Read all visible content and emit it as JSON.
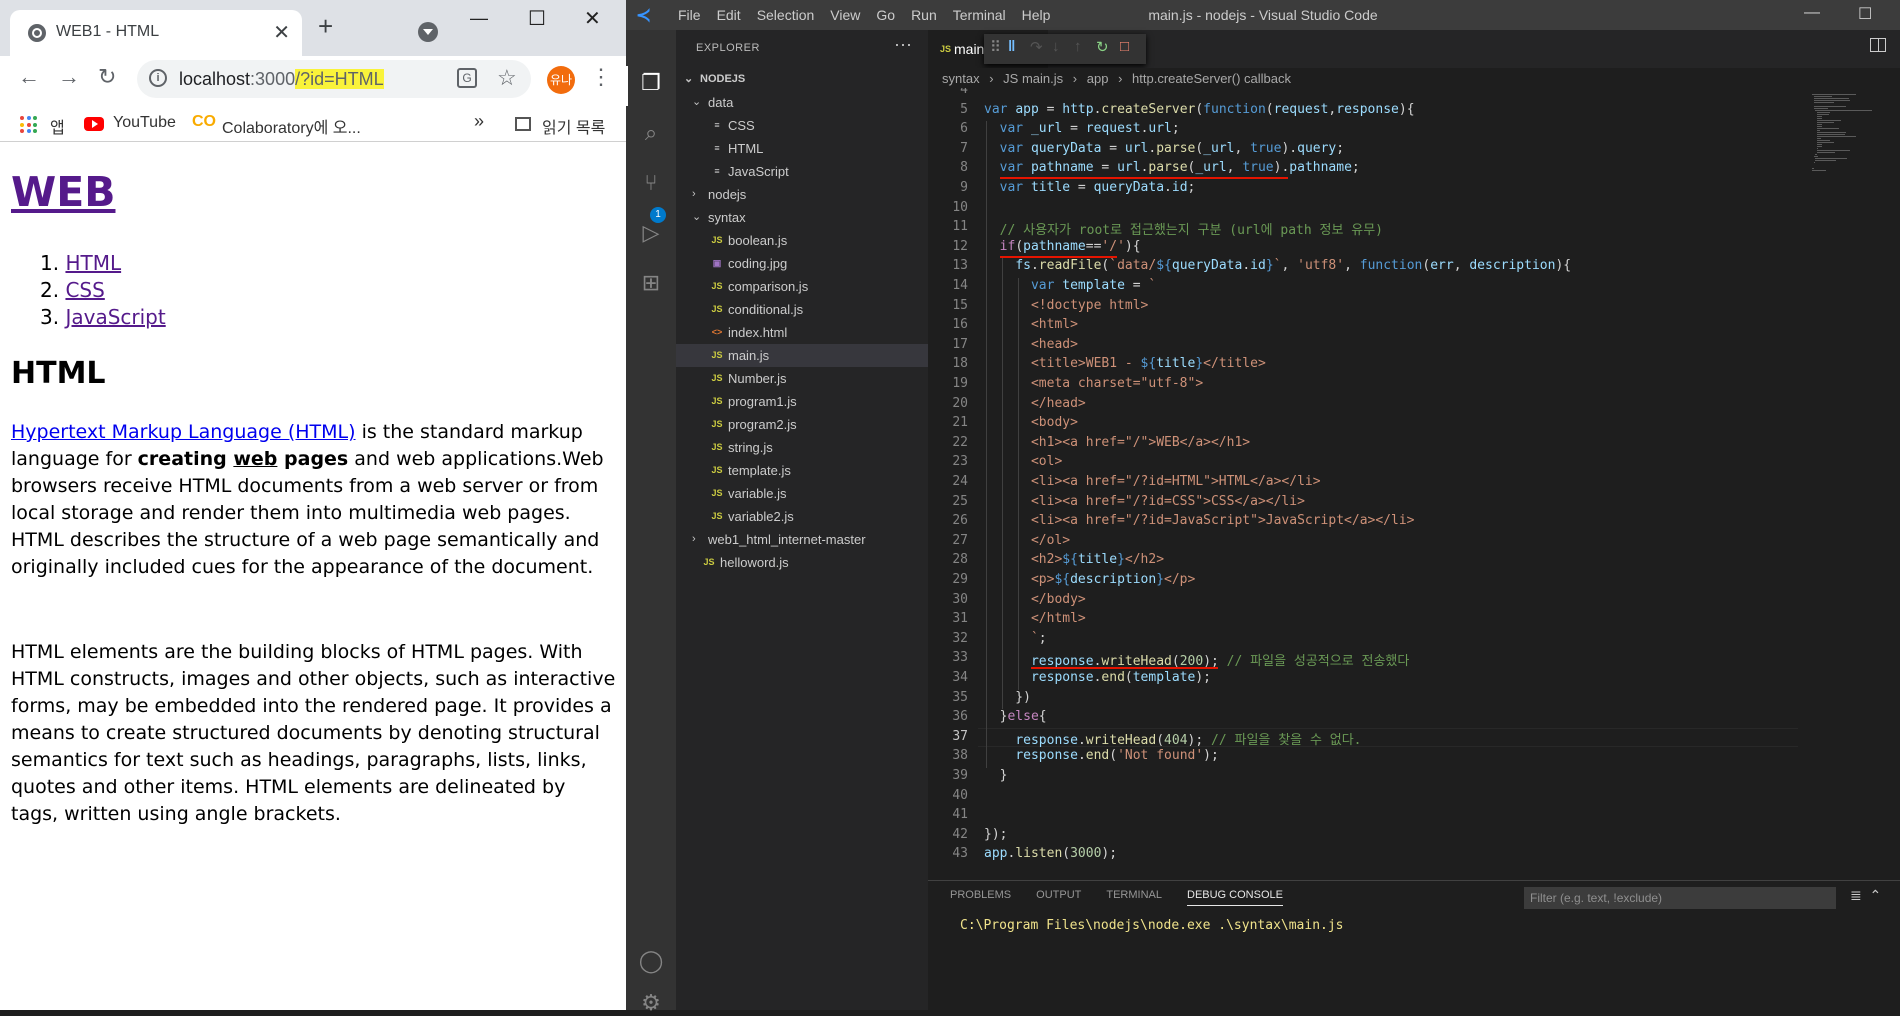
{
  "browser": {
    "tab_title": "WEB1 - HTML",
    "url_host": "localhost",
    "url_port": ":3000",
    "url_query": "/?id=HTML",
    "profile_label": "유나",
    "bookmarks": {
      "apps": "앱",
      "youtube": "YouTube",
      "colab": "Colaboratory에 오...",
      "more": "»",
      "reading_list": "읽기 목록"
    }
  },
  "page": {
    "h1": "WEB",
    "list": [
      {
        "num": "1.",
        "label": "HTML"
      },
      {
        "num": "2.",
        "label": "CSS"
      },
      {
        "num": "3.",
        "label": "JavaScript"
      }
    ],
    "h2": "HTML",
    "p1_link": "Hypertext Markup Language (HTML)",
    "p1_a": " is the standard markup language for ",
    "p1_b1": "creating ",
    "p1_b2": "web",
    "p1_b3": " pages",
    "p1_c": " and web applications.Web browsers receive HTML documents from a web server or from local storage and render them into multimedia web pages. HTML describes the structure of a web page semantically and originally included cues for the appearance of the document.",
    "p2": "HTML elements are the building blocks of HTML pages. With HTML constructs, images and other objects, such as interactive forms, may be embedded into the rendered page. It provides a means to create structured documents by denoting structural semantics for text such as headings, paragraphs, lists, links, quotes and other items. HTML elements are delineated by tags, written using angle brackets."
  },
  "vscode": {
    "title": "main.js - nodejs - Visual Studio Code",
    "menus": [
      "File",
      "Edit",
      "Selection",
      "View",
      "Go",
      "Run",
      "Terminal",
      "Help"
    ],
    "explorer_header": "EXPLORER",
    "debug_badge": "1",
    "tree": [
      {
        "label": "NODEJS",
        "depth": 0,
        "type": "root"
      },
      {
        "label": "data",
        "depth": 1,
        "type": "folder-open"
      },
      {
        "label": "CSS",
        "depth": 2,
        "type": "file"
      },
      {
        "label": "HTML",
        "depth": 2,
        "type": "file"
      },
      {
        "label": "JavaScript",
        "depth": 2,
        "type": "file"
      },
      {
        "label": "nodejs",
        "depth": 1,
        "type": "folder-closed"
      },
      {
        "label": "syntax",
        "depth": 1,
        "type": "folder-open"
      },
      {
        "label": "boolean.js",
        "depth": 2,
        "type": "js"
      },
      {
        "label": "coding.jpg",
        "depth": 2,
        "type": "img"
      },
      {
        "label": "comparison.js",
        "depth": 2,
        "type": "js"
      },
      {
        "label": "conditional.js",
        "depth": 2,
        "type": "js"
      },
      {
        "label": "index.html",
        "depth": 2,
        "type": "html"
      },
      {
        "label": "main.js",
        "depth": 2,
        "type": "js",
        "selected": true
      },
      {
        "label": "Number.js",
        "depth": 2,
        "type": "js"
      },
      {
        "label": "program1.js",
        "depth": 2,
        "type": "js"
      },
      {
        "label": "program2.js",
        "depth": 2,
        "type": "js"
      },
      {
        "label": "string.js",
        "depth": 2,
        "type": "js"
      },
      {
        "label": "template.js",
        "depth": 2,
        "type": "js"
      },
      {
        "label": "variable.js",
        "depth": 2,
        "type": "js"
      },
      {
        "label": "variable2.js",
        "depth": 2,
        "type": "js"
      },
      {
        "label": "web1_html_internet-master",
        "depth": 1,
        "type": "folder-closed"
      },
      {
        "label": "helloword.js",
        "depth": 1,
        "type": "js"
      }
    ],
    "editor_tab": "main.js",
    "breadcrumbs": [
      "syntax",
      "›",
      "JS main.js",
      "›",
      "app",
      "›",
      "http.createServer() callback"
    ],
    "current_line": 37,
    "code": [
      {
        "n": 4,
        "h": ""
      },
      {
        "n": 5,
        "h": "<span class=k>var</span> <span class=v>app</span> = <span class=v>http</span>.<span class=f>createServer</span>(<span class=k>function</span>(<span class=v>request</span>,<span class=v>response</span>){"
      },
      {
        "n": 6,
        "h": "  <span class=k>var</span> <span class=v>_url</span> = <span class=v>request</span>.<span class=v>url</span>;"
      },
      {
        "n": 7,
        "h": "  <span class=k>var</span> <span class=v>queryData</span> = <span class=v>url</span>.<span class=f>parse</span>(<span class=v>_url</span>, <span class=k>true</span>).<span class=v>query</span>;"
      },
      {
        "n": 8,
        "h": "  <span class=k>var</span> <span class=v>pathname</span> = <span class=v>url</span>.<span class=f>parse</span>(<span class=v>_url</span>, <span class=k>true</span>).<span class=v>pathname</span>;"
      },
      {
        "n": 9,
        "h": "  <span class=k>var</span> <span class=v>title</span> = <span class=v>queryData</span>.<span class=v>id</span>;"
      },
      {
        "n": 10,
        "h": ""
      },
      {
        "n": 11,
        "h": "  <span class=c>// 사용자가 root로 접근했는지 구분 (url에 path 정보 유무)</span>"
      },
      {
        "n": 12,
        "h": "  <span class=pk>if</span>(<span class=v>pathname</span>==<span class=s>'/'</span>){"
      },
      {
        "n": 13,
        "h": "    <span class=v>fs</span>.<span class=f>readFile</span>(<span class=s>`data/</span><span class=k>${</span><span class=v>queryData</span>.<span class=v>id</span><span class=k>}</span><span class=s>`</span>, <span class=s>'utf8'</span>, <span class=k>function</span>(<span class=v>err</span>, <span class=v>description</span>){"
      },
      {
        "n": 14,
        "h": "      <span class=k>var</span> <span class=v>template</span> = <span class=s>`</span>"
      },
      {
        "n": 15,
        "h": "      <span class=s>&lt;!doctype html&gt;</span>"
      },
      {
        "n": 16,
        "h": "      <span class=s>&lt;html&gt;</span>"
      },
      {
        "n": 17,
        "h": "      <span class=s>&lt;head&gt;</span>"
      },
      {
        "n": 18,
        "h": "      <span class=s>&lt;title&gt;WEB1 - </span><span class=k>${</span><span class=v>title</span><span class=k>}</span><span class=s>&lt;/title&gt;</span>"
      },
      {
        "n": 19,
        "h": "      <span class=s>&lt;meta charset=\"utf-8\"&gt;</span>"
      },
      {
        "n": 20,
        "h": "      <span class=s>&lt;/head&gt;</span>"
      },
      {
        "n": 21,
        "h": "      <span class=s>&lt;body&gt;</span>"
      },
      {
        "n": 22,
        "h": "      <span class=s>&lt;h1&gt;&lt;a href=\"/\"&gt;WEB&lt;/a&gt;&lt;/h1&gt;</span>"
      },
      {
        "n": 23,
        "h": "      <span class=s>&lt;ol&gt;</span>"
      },
      {
        "n": 24,
        "h": "      <span class=s>&lt;li&gt;&lt;a href=\"/?id=HTML\"&gt;HTML&lt;/a&gt;&lt;/li&gt;</span>"
      },
      {
        "n": 25,
        "h": "      <span class=s>&lt;li&gt;&lt;a href=\"/?id=CSS\"&gt;CSS&lt;/a&gt;&lt;/li&gt;</span>"
      },
      {
        "n": 26,
        "h": "      <span class=s>&lt;li&gt;&lt;a href=\"/?id=JavaScript\"&gt;JavaScript&lt;/a&gt;&lt;/li&gt;</span>"
      },
      {
        "n": 27,
        "h": "      <span class=s>&lt;/ol&gt;</span>"
      },
      {
        "n": 28,
        "h": "      <span class=s>&lt;h2&gt;</span><span class=k>${</span><span class=v>title</span><span class=k>}</span><span class=s>&lt;/h2&gt;</span>"
      },
      {
        "n": 29,
        "h": "      <span class=s>&lt;p&gt;</span><span class=k>${</span><span class=v>description</span><span class=k>}</span><span class=s>&lt;/p&gt;</span>"
      },
      {
        "n": 30,
        "h": "      <span class=s>&lt;/body&gt;</span>"
      },
      {
        "n": 31,
        "h": "      <span class=s>&lt;/html&gt;</span>"
      },
      {
        "n": 32,
        "h": "      <span class=s>`</span>;"
      },
      {
        "n": 33,
        "h": "      <span class=v>response</span>.<span class=f>writeHead</span>(<span class=n>200</span>); <span class=c>// 파일을 성공적으로 전송했다</span>"
      },
      {
        "n": 34,
        "h": "      <span class=v>response</span>.<span class=f>end</span>(<span class=v>template</span>);"
      },
      {
        "n": 35,
        "h": "    })"
      },
      {
        "n": 36,
        "h": "  }<span class=pk>else</span>{"
      },
      {
        "n": 37,
        "h": "    <span class=v>response</span>.<span class=f>writeHead</span>(<span class=n>404</span>); <span class=c>// 파일을 찾을 수 없다.</span>"
      },
      {
        "n": 38,
        "h": "    <span class=v>response</span>.<span class=f>end</span>(<span class=s>'Not found'</span>);"
      },
      {
        "n": 39,
        "h": "  }"
      },
      {
        "n": 40,
        "h": ""
      },
      {
        "n": 41,
        "h": ""
      },
      {
        "n": 42,
        "h": "});"
      },
      {
        "n": 43,
        "h": "<span class=v>app</span>.<span class=f>listen</span>(<span class=n>3000</span>);"
      }
    ],
    "panel_tabs": [
      "PROBLEMS",
      "OUTPUT",
      "TERMINAL",
      "DEBUG CONSOLE"
    ],
    "panel_filter_placeholder": "Filter (e.g. text, !exclude)",
    "panel_output": "C:\\Program Files\\nodejs\\node.exe .\\syntax\\main.js"
  }
}
